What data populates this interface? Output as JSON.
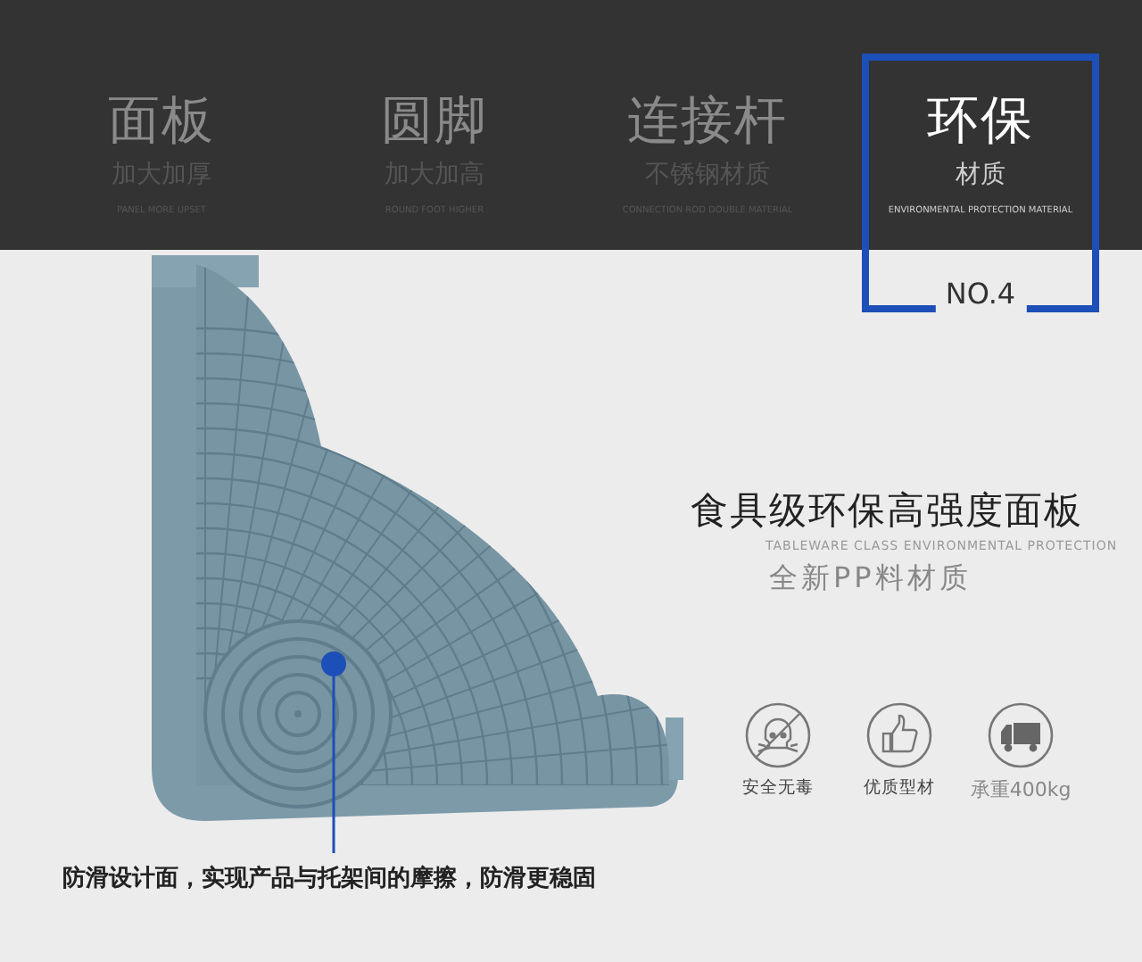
{
  "tabs": [
    {
      "title": "面板",
      "subtitle": "加大加厚",
      "english": "PANEL MORE UPSET",
      "selected": false
    },
    {
      "title": "圆脚",
      "subtitle": "加大加高",
      "english": "ROUND FOOT HIGHER",
      "selected": false
    },
    {
      "title": "连接杆",
      "subtitle": "不锈钢材质",
      "english": "CONNECTION ROD DOUBLE MATERIAL",
      "selected": false
    },
    {
      "title": "环保",
      "subtitle": "材质",
      "english": "ENVIRONMENTAL PROTECTION MATERIAL",
      "selected": true,
      "badge": "NO.4"
    }
  ],
  "feature": {
    "title": "食具级环保高强度面板",
    "english": "TABLEWARE CLASS ENVIRONMENTAL PROTECTION",
    "subtitle": "全新PP料材质"
  },
  "badges": [
    {
      "kind": "no-poison",
      "label": "安全无毒"
    },
    {
      "kind": "quality",
      "label": "优质型材"
    },
    {
      "kind": "load",
      "label": "承重400kg"
    }
  ],
  "callout": "防滑设计面，实现产品与托架间的摩擦，防滑更稳固"
}
